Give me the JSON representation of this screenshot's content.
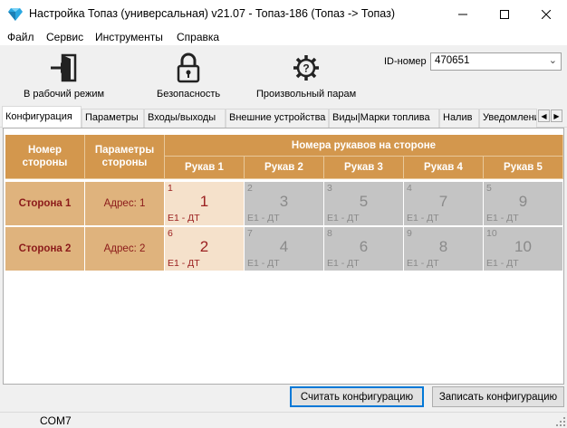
{
  "window": {
    "title": "Настройка Топаз (универсальная) v21.07 - Топаз-186 (Топаз -> Топаз)",
    "min": "—",
    "max": "☐",
    "close": "✕"
  },
  "menu": [
    "Файл",
    "Сервис",
    "Инструменты",
    "Справка"
  ],
  "toolbar": {
    "work_mode": "В рабочий режим",
    "security": "Безопасность",
    "custom_param": "Произвольный парам",
    "id_label": "ID-номер",
    "id_value": "470651"
  },
  "tabs": [
    "Конфигурация",
    "Параметры",
    "Входы/выходы",
    "Внешние устройства",
    "Виды|Марки топлива",
    "Налив",
    "Уведомлени"
  ],
  "grid": {
    "hdr_side": "Номер стороны",
    "hdr_params": "Параметры стороны",
    "hdr_hoses": "Номера рукавов на стороне",
    "hose_headers": [
      "Рукав 1",
      "Рукав 2",
      "Рукав 3",
      "Рукав 4",
      "Рукав 5"
    ],
    "rows": [
      {
        "name": "Сторона 1",
        "addr": "Адрес: 1",
        "hoses": [
          {
            "n": "1",
            "big": "1",
            "fuel": "E1 - ДТ",
            "active": true
          },
          {
            "n": "2",
            "big": "3",
            "fuel": "E1 - ДТ",
            "active": false
          },
          {
            "n": "3",
            "big": "5",
            "fuel": "E1 - ДТ",
            "active": false
          },
          {
            "n": "4",
            "big": "7",
            "fuel": "E1 - ДТ",
            "active": false
          },
          {
            "n": "5",
            "big": "9",
            "fuel": "E1 - ДТ",
            "active": false
          }
        ]
      },
      {
        "name": "Сторона 2",
        "addr": "Адрес: 2",
        "hoses": [
          {
            "n": "6",
            "big": "2",
            "fuel": "E1 - ДТ",
            "active": true
          },
          {
            "n": "7",
            "big": "4",
            "fuel": "E1 - ДТ",
            "active": false
          },
          {
            "n": "8",
            "big": "6",
            "fuel": "E1 - ДТ",
            "active": false
          },
          {
            "n": "9",
            "big": "8",
            "fuel": "E1 - ДТ",
            "active": false
          },
          {
            "n": "10",
            "big": "10",
            "fuel": "E1 - ДТ",
            "active": false
          }
        ]
      }
    ]
  },
  "buttons": {
    "read": "Считать конфигурацию",
    "write": "Записать конфигурацию"
  },
  "status": {
    "port": "COM7"
  },
  "colors": {
    "header": "#d3974d",
    "side": "#dfb37d",
    "active_hose": "#f5e1cb",
    "inactive_hose": "#c4c4c4",
    "accent_text": "#9b2020"
  }
}
